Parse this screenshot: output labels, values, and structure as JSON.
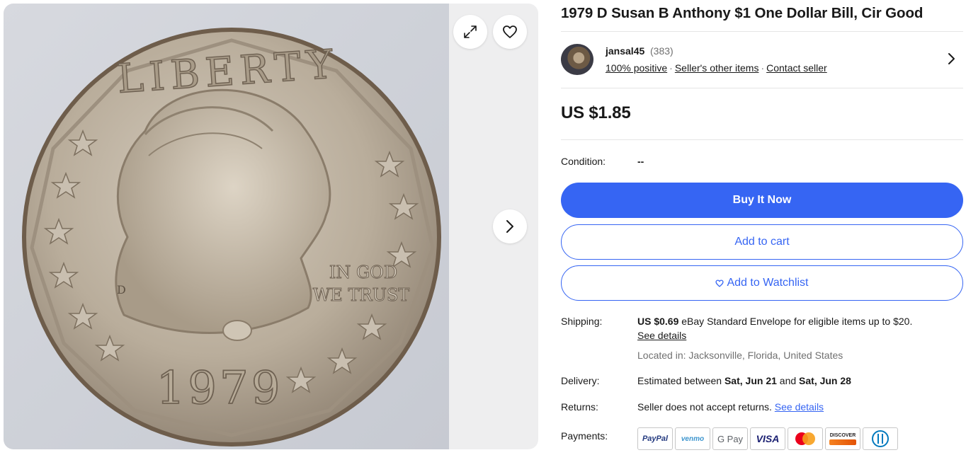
{
  "listing": {
    "title": "1979 D Susan B Anthony $1 One Dollar Bill, Cir Good",
    "price": "US $1.85"
  },
  "gallery": {
    "coin_legend": "LIBERTY",
    "coin_motto_1": "IN GOD",
    "coin_motto_2": "WE TRUST",
    "coin_year": "1979",
    "coin_mint": "D",
    "icons": {
      "expand": "expand-icon",
      "watch": "heart-icon",
      "next": "chevron-right-icon"
    }
  },
  "seller": {
    "name": "jansal45",
    "count": "(383)",
    "feedback": "100% positive",
    "other_items": "Seller's other items",
    "contact": "Contact seller"
  },
  "condition": {
    "label": "Condition:",
    "value": "--"
  },
  "buttons": {
    "buy_now": "Buy It Now",
    "add_to_cart": "Add to cart",
    "add_to_watchlist": "Add to Watchlist"
  },
  "shipping": {
    "label": "Shipping:",
    "price": "US $0.69",
    "description": "eBay Standard Envelope for eligible items up to $20.",
    "details_link": "See details",
    "location": "Located in: Jacksonville, Florida, United States"
  },
  "delivery": {
    "label": "Delivery:",
    "prefix": "Estimated between",
    "start": "Sat, Jun 21",
    "and": "and",
    "end": "Sat, Jun 28"
  },
  "returns": {
    "label": "Returns:",
    "text": "Seller does not accept returns.",
    "details_link": "See details"
  },
  "payments": {
    "label": "Payments:",
    "methods": [
      "PayPal",
      "venmo",
      "G Pay",
      "VISA",
      "Mastercard",
      "DISCOVER",
      "Diners Club"
    ]
  },
  "colors": {
    "accent": "#3665f3",
    "text": "#191919",
    "muted": "#707070"
  }
}
